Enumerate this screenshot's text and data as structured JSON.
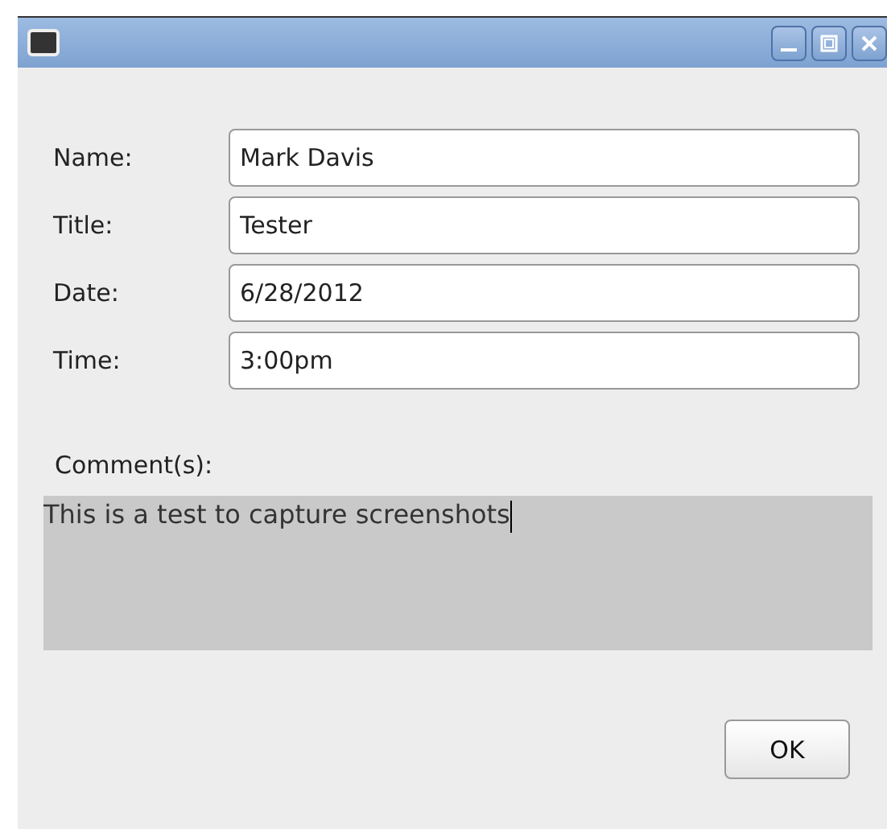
{
  "fields": [
    {
      "label": "Name:",
      "value": "Mark Davis"
    },
    {
      "label": "Title:",
      "value": "Tester"
    },
    {
      "label": "Date:",
      "value": "6/28/2012"
    },
    {
      "label": "Time:",
      "value": "3:00pm"
    }
  ],
  "comments": {
    "label": "Comment(s):",
    "value": "This is a test to capture screenshots"
  },
  "buttons": [
    "OK"
  ]
}
